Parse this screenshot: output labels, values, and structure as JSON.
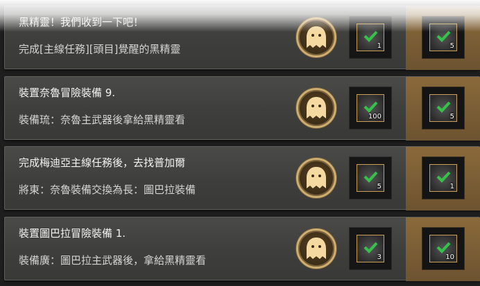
{
  "quests": [
    {
      "title": "黑精靈！我們收到一下吧！",
      "desc": "完成[主線任務][頭目]覺醒的黑精靈",
      "reward1": {
        "icon": "feather-quill-icon",
        "qty": "1"
      },
      "reward2": {
        "icon": "feather-quill-icon",
        "qty": "5"
      }
    },
    {
      "title": "裝置奈魯冒險裝備 9.",
      "desc": "裝備琉：奈魯主武器後拿給黑精靈看",
      "reward1": {
        "icon": "ore-stone-icon",
        "qty": "100"
      },
      "reward2": {
        "icon": "crystal-orb-icon",
        "qty": "5"
      }
    },
    {
      "title": "完成梅迪亞主線任務後，去找普加爾",
      "desc": "將東：奈魯裝備交換為長：圖巴拉裝備",
      "reward1": {
        "icon": "feather-quill-icon",
        "qty": "5"
      },
      "reward2": {
        "icon": "dark-box-icon",
        "qty": "1"
      }
    },
    {
      "title": "裝置圖巴拉冒險裝備 1.",
      "desc": "裝備廣：圖巴拉主武器後，拿給黑精靈看",
      "reward1": {
        "icon": "scroll-icon",
        "qty": "3"
      },
      "reward2": {
        "icon": "feather-quill-icon",
        "qty": "10"
      }
    }
  ],
  "colors": {
    "check": "#36c24a",
    "emblem_gold": "#cfae72",
    "highlight_slot": "#8a6a3b"
  }
}
